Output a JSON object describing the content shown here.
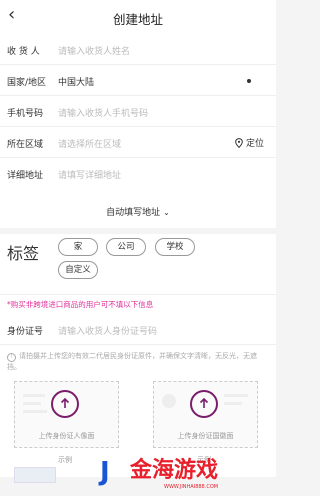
{
  "header": {
    "title": "创建地址",
    "back_glyph": "‹"
  },
  "form": {
    "recipient": {
      "label": "收 货 人",
      "placeholder": "请输入收货人姓名"
    },
    "region": {
      "label": "国家/地区",
      "value": "中国大陆"
    },
    "phone": {
      "label": "手机号码",
      "placeholder": "请输入收货人手机号码"
    },
    "area": {
      "label": "所在区域",
      "placeholder": "请选择所在区域",
      "locate_label": "定位"
    },
    "address": {
      "label": "详细地址",
      "placeholder": "请填写详细地址"
    }
  },
  "autofill": {
    "label": "自动填写地址",
    "chevron": "⌄"
  },
  "tags": {
    "label": "标签",
    "items": [
      "家",
      "公司",
      "学校",
      "自定义"
    ]
  },
  "notice": "*购买非跨境进口商品的用户可不填以下信息",
  "id_card": {
    "label": "身份证号",
    "placeholder": "请输入收货人身份证号码"
  },
  "hint": "请拍摄并上传您的有效二代居民身份证原件，并确保文字清晰，无反光，无遮挡。",
  "uploads": {
    "front": "上传身份证人像面",
    "back": "上传身份证国徽面",
    "example_label": "示例"
  },
  "watermark": {
    "logo": "J",
    "text": "金海游戏",
    "url": "WWW.JINHAI888.COM"
  },
  "colors": {
    "accent": "#7a1d6a",
    "notice": "#e0329a",
    "placeholder": "#bbbbbb"
  }
}
